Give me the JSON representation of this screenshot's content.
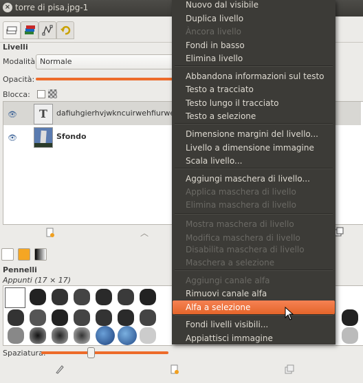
{
  "window": {
    "title": "torre di pisa.jpg-1",
    "close_glyph": "×"
  },
  "tabs": [
    {
      "icon": "layers-icon"
    },
    {
      "icon": "channels-icon"
    },
    {
      "icon": "paths-icon"
    },
    {
      "icon": "undo-history-icon"
    }
  ],
  "layers_panel": {
    "heading": "Livelli",
    "mode_label": "Modalità:",
    "mode_value": "Normale",
    "opacity_label": "Opacità:",
    "opacity_value": 1.0,
    "lock_label": "Blocca:",
    "layers": [
      {
        "name": "dafiuhgierhvjwkncuirwehfiurwev...",
        "type_glyph": "T",
        "selected": true
      },
      {
        "name": "Sfondo",
        "selected": false
      }
    ]
  },
  "brushes_panel": {
    "heading": "Pennelli",
    "subtitle": "Appunti (17 × 17)",
    "spacing_label": "Spaziatura:",
    "spacing_value": 0.38
  },
  "context_menu": {
    "items": [
      {
        "label": "Nuovo dal visibile",
        "enabled": true
      },
      {
        "label": "Duplica livello",
        "enabled": true
      },
      {
        "label": "Àncora livello",
        "enabled": false
      },
      {
        "label": "Fondi in basso",
        "enabled": true
      },
      {
        "label": "Elimina livello",
        "enabled": true
      },
      {
        "label": "Abbandona informazioni sul testo",
        "enabled": true
      },
      {
        "label": "Testo a tracciato",
        "enabled": true
      },
      {
        "label": "Testo lungo il tracciato",
        "enabled": true
      },
      {
        "label": "Testo a selezione",
        "enabled": true
      },
      {
        "label": "Dimensione margini del livello...",
        "enabled": true
      },
      {
        "label": "Livello a dimensione immagine",
        "enabled": true
      },
      {
        "label": "Scala livello...",
        "enabled": true
      },
      {
        "label": "Aggiungi maschera di livello...",
        "enabled": true
      },
      {
        "label": "Applica maschera di livello",
        "enabled": false
      },
      {
        "label": "Elimina maschera di livello",
        "enabled": false
      },
      {
        "label": "Mostra maschera di livello",
        "enabled": false
      },
      {
        "label": "Modifica maschera di livello",
        "enabled": false
      },
      {
        "label": "Disabilita maschera di livello",
        "enabled": false
      },
      {
        "label": "Maschera a selezione",
        "enabled": false
      },
      {
        "label": "Aggiungi canale alfa",
        "enabled": false
      },
      {
        "label": "Rimuovi canale alfa",
        "enabled": true
      },
      {
        "label": "Alfa a selezione",
        "enabled": true,
        "highlighted": true
      },
      {
        "label": "Fondi livelli visibili...",
        "enabled": true
      },
      {
        "label": "Appiattisci immagine",
        "enabled": true
      }
    ]
  },
  "colors": {
    "accent": "#ed6b2a",
    "menu_bg": "#3c3b37",
    "menu_text": "#dfdbd2",
    "menu_disabled": "#6b6a65"
  }
}
